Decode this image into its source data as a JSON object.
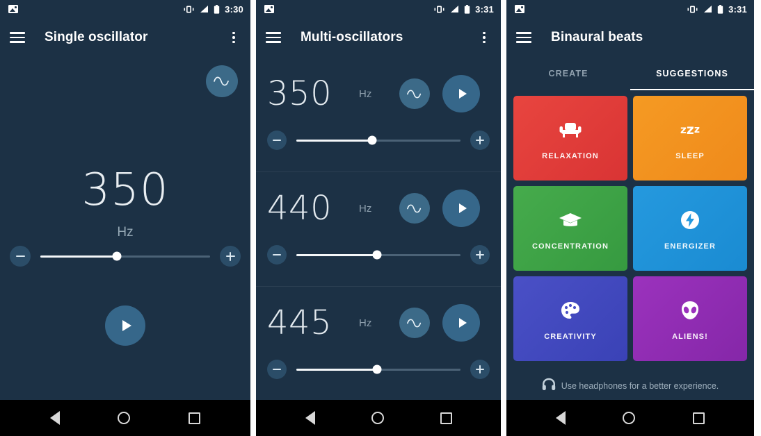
{
  "screens": [
    {
      "id": "single-oscillator",
      "statusbar": {
        "time": "3:30",
        "icons": [
          "photo-icon",
          "vibrate-icon",
          "signal-icon",
          "battery-icon"
        ]
      },
      "appbar": {
        "title": "Single oscillator",
        "menu_icon": "hamburger-icon",
        "overflow_icon": "kebab-icon"
      },
      "waveform_icon": "sine-wave-icon",
      "frequency": "350",
      "unit": "Hz",
      "slider": {
        "value_percent": 45,
        "decrement_icon": "minus-icon",
        "increment_icon": "plus-icon"
      },
      "play_icon": "play-icon"
    },
    {
      "id": "multi-oscillators",
      "statusbar": {
        "time": "3:31",
        "icons": [
          "photo-icon",
          "vibrate-icon",
          "signal-icon",
          "battery-icon"
        ]
      },
      "appbar": {
        "title": "Multi-oscillators",
        "menu_icon": "hamburger-icon",
        "overflow_icon": "kebab-icon"
      },
      "oscillators": [
        {
          "frequency": "350",
          "unit": "Hz",
          "waveform_icon": "sine-wave-icon",
          "play_icon": "play-icon",
          "slider": {
            "value_percent": 46
          }
        },
        {
          "frequency": "440",
          "unit": "Hz",
          "waveform_icon": "sine-wave-icon",
          "play_icon": "play-icon",
          "slider": {
            "value_percent": 49
          }
        },
        {
          "frequency": "445",
          "unit": "Hz",
          "waveform_icon": "sine-wave-icon",
          "play_icon": "play-icon",
          "slider": {
            "value_percent": 49
          }
        }
      ]
    },
    {
      "id": "binaural-beats",
      "statusbar": {
        "time": "3:31",
        "icons": [
          "photo-icon",
          "vibrate-icon",
          "signal-icon",
          "battery-icon"
        ]
      },
      "appbar": {
        "title": "Binaural beats",
        "menu_icon": "hamburger-icon"
      },
      "tabs": [
        {
          "label": "CREATE",
          "active": false
        },
        {
          "label": "SUGGESTIONS",
          "active": true
        }
      ],
      "cards": [
        {
          "label": "RELAXATION",
          "color": "#e33b3b",
          "icon": "armchair-icon"
        },
        {
          "label": "SLEEP",
          "color": "#f29021",
          "icon": "zzz-icon"
        },
        {
          "label": "CONCENTRATION",
          "color": "#3ea346",
          "icon": "graduation-cap-icon"
        },
        {
          "label": "ENERGIZER",
          "color": "#1e92d9",
          "icon": "lightning-bolt-icon"
        },
        {
          "label": "CREATIVITY",
          "color": "#4048be",
          "icon": "palette-icon"
        },
        {
          "label": "ALIENS!",
          "color": "#8f2bb0",
          "icon": "alien-icon"
        }
      ],
      "footer": {
        "icon": "headphones-icon",
        "text": "Use headphones for a better experience."
      }
    }
  ],
  "navbar": {
    "back_icon": "back-triangle-icon",
    "home_icon": "home-circle-icon",
    "recents_icon": "recents-square-icon"
  },
  "theme": {
    "background": "#1c3145",
    "accent": "#36678a",
    "sine_button": "#3c6a88",
    "track_active": "#f4f7f9",
    "track_inactive": "#4b6276"
  }
}
